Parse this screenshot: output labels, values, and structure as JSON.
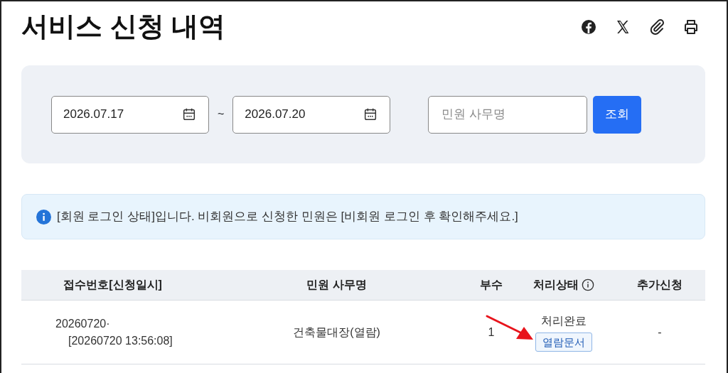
{
  "title": "서비스 신청 내역",
  "share_icons": [
    {
      "kind": "facebook"
    },
    {
      "kind": "x"
    },
    {
      "kind": "link"
    },
    {
      "kind": "print"
    }
  ],
  "search": {
    "date_from": "2026.07.17",
    "separator": "~",
    "date_to": "2026.07.20",
    "keyword_placeholder": "민원 사무명",
    "button": "조회"
  },
  "notice": "[회원 로그인 상태]입니다. 비회원으로 신청한 민원은 [비회원 로그인 후 확인해주세요.]",
  "table": {
    "columns": [
      {
        "label": "접수번호[신청일시]"
      },
      {
        "label": "민원 사무명"
      },
      {
        "label": "부수"
      },
      {
        "label": "처리상태",
        "info": true
      },
      {
        "label": "추가신청"
      }
    ],
    "rows": [
      {
        "receipt_no": "20260720·",
        "requested_at": "[20260720 13:56:08]",
        "service": "건축물대장(열람)",
        "copies": "1",
        "status": "처리완료",
        "document_button": "열람문서",
        "extra": "-"
      }
    ]
  },
  "annotation": {
    "kind": "arrow"
  }
}
